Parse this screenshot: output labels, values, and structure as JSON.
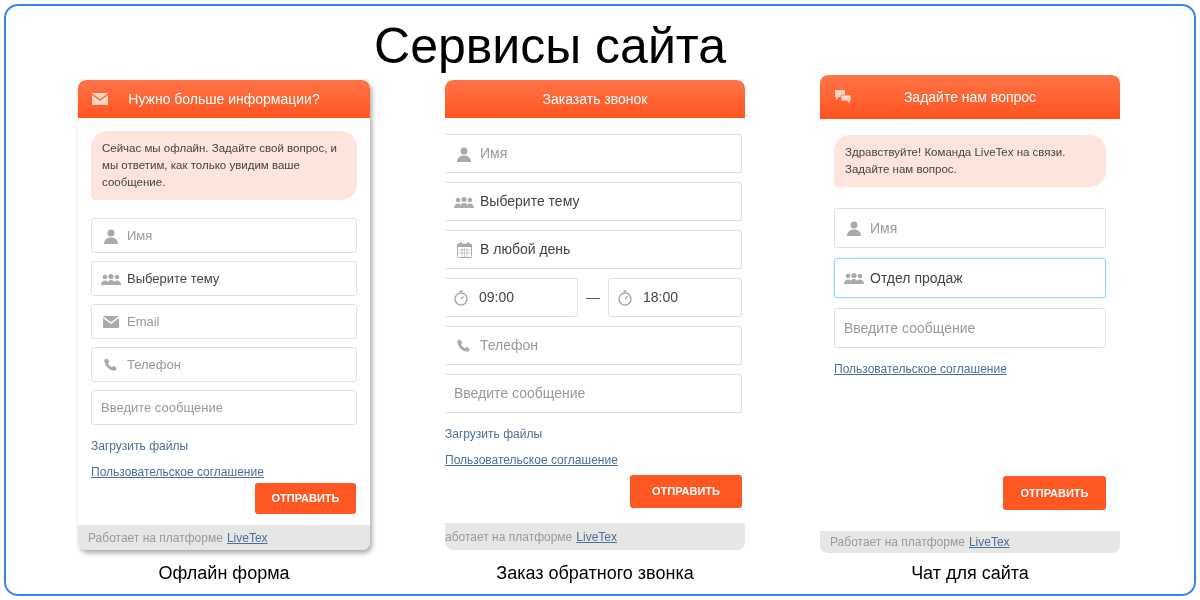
{
  "title": "Сервисы сайта",
  "widgets": [
    {
      "kind": "offline",
      "header": "Нужно больше информации?",
      "bubble": "Сейчас мы офлайн. Задайте свой вопрос, и мы ответим, как только увидим ваше сообщение.",
      "fields": [
        {
          "kind": "name",
          "placeholder": "Имя",
          "focused": false
        },
        {
          "kind": "topic",
          "value": "Выберите тему",
          "focused": false
        },
        {
          "kind": "email",
          "placeholder": "Email",
          "focused": false
        },
        {
          "kind": "phone",
          "placeholder": "Телефон",
          "focused": false
        },
        {
          "kind": "message",
          "placeholder": "Введите сообщение",
          "focused": false
        }
      ],
      "upload_link": "Загрузить файлы",
      "agreement_link": "Пользовательское соглашение",
      "button": "ОТПРАВИТЬ",
      "footer": {
        "text": "Работает на платформе",
        "link": "LiveTex"
      },
      "caption": "Офлайн форма"
    },
    {
      "kind": "callback",
      "header": "Заказать звонок",
      "fields": [
        {
          "kind": "name",
          "placeholder": "Имя",
          "focused": false
        },
        {
          "kind": "topic",
          "value": "Выберите тему",
          "focused": false
        },
        {
          "kind": "date",
          "value": "В любой день",
          "focused": false
        },
        {
          "kind": "time_range",
          "from": "09:00",
          "separator": "—",
          "to": "18:00",
          "focused": false
        },
        {
          "kind": "phone",
          "placeholder": "Телефон",
          "focused": false
        },
        {
          "kind": "message",
          "placeholder": "Введите сообщение",
          "focused": false
        }
      ],
      "upload_link": "Загрузить файлы",
      "agreement_link": "Пользовательское соглашение",
      "button": "ОТПРАВИТЬ",
      "footer": {
        "text": "аботает на платформе",
        "link": "LiveTex"
      },
      "caption": "Заказ обратного звонка"
    },
    {
      "kind": "chat",
      "header": "Задайте нам вопрос",
      "bubble": "Здравствуйте! Команда LiveTex на связи. Задайте нам вопрос.",
      "fields": [
        {
          "kind": "name",
          "placeholder": "Имя",
          "focused": false
        },
        {
          "kind": "topic",
          "value": "Отдел продаж",
          "focused": true
        },
        {
          "kind": "message",
          "placeholder": "Введите сообщение",
          "focused": false
        }
      ],
      "agreement_link": "Пользовательское соглашение",
      "button": "ОТПРАВИТЬ",
      "footer": {
        "text": "Работает на платформе",
        "link": "LiveTex"
      },
      "caption": "Чат для сайта"
    }
  ]
}
